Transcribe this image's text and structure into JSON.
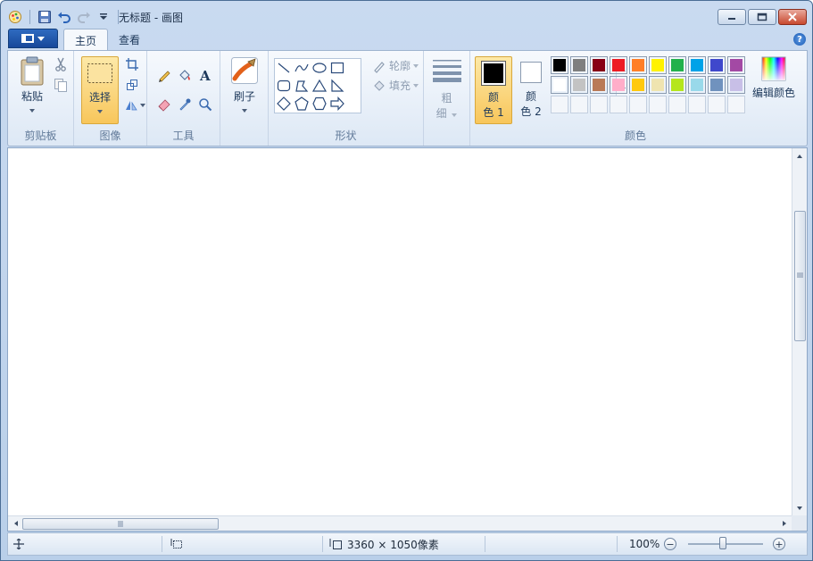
{
  "window": {
    "title": "无标题 - 画图"
  },
  "tabs": [
    {
      "label": "主页",
      "active": true
    },
    {
      "label": "查看",
      "active": false
    }
  ],
  "groups": {
    "clipboard": {
      "label": "剪贴板",
      "paste_label": "粘贴"
    },
    "image": {
      "label": "图像",
      "select_label": "选择"
    },
    "tools": {
      "label": "工具"
    },
    "brushes": {
      "label": "刷子"
    },
    "shapes": {
      "label": "形状",
      "outline_label": "轮廓",
      "fill_label": "填充"
    },
    "size": {
      "label_line1": "粗",
      "label_line2": "细"
    },
    "colors": {
      "label": "颜色",
      "color1_label_line1": "颜",
      "color1_label_line2": "色 1",
      "color2_label_line1": "颜",
      "color2_label_line2": "色 2",
      "edit_colors_label": "编辑颜色",
      "color1_value": "#000000",
      "color2_value": "#ffffff",
      "palette_row1": [
        "#000000",
        "#7f7f7f",
        "#880015",
        "#ed1c24",
        "#ff7f27",
        "#fff200",
        "#22b14c",
        "#00a2e8",
        "#3f48cc",
        "#a349a4"
      ],
      "palette_row2": [
        "#ffffff",
        "#c3c3c3",
        "#b97a57",
        "#ffaec9",
        "#ffc90e",
        "#efe4b0",
        "#b5e61d",
        "#99d9ea",
        "#7092be",
        "#c8bfe7"
      ]
    }
  },
  "status": {
    "image_size": "3360 × 1050像素",
    "zoom": "100%"
  },
  "colors": {
    "accent": "#1d5cb5",
    "highlight": "#f8c65b"
  }
}
